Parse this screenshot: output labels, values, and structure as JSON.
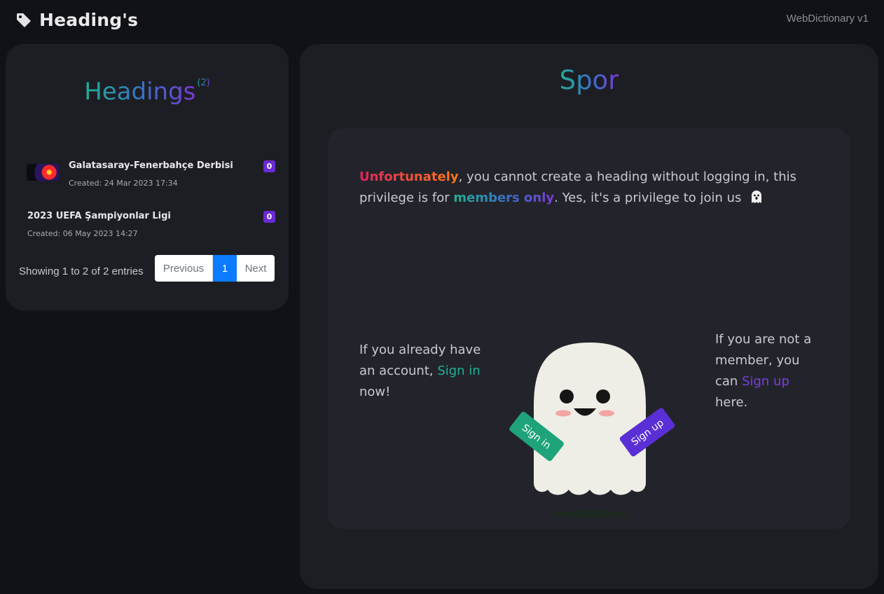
{
  "header": {
    "title": "Heading's",
    "title_icon": "tag-icon",
    "app_version": "WebDictionary v1"
  },
  "sidebar": {
    "title": "Headings",
    "count": "(2)",
    "items": [
      {
        "name": "Galatasaray-Fenerbahçe Derbisi",
        "created": "Created: 24 Mar 2023 17:34",
        "badge": "0",
        "has_thumbnail": true
      },
      {
        "name": "2023 UEFA Şampiyonlar Ligi",
        "created": "Created: 06 May 2023 14:27",
        "badge": "0",
        "has_thumbnail": false
      }
    ],
    "entries_info": "Showing 1 to 2 of 2 entries",
    "pagination": {
      "previous": "Previous",
      "current": "1",
      "next": "Next"
    }
  },
  "main": {
    "title": "Spor",
    "notice": {
      "warn": "Unfortunately",
      "part1": ", you cannot create a heading without logging in, this privilege is for ",
      "members": "members only",
      "part2": ". Yes, it's a privilege to join us"
    },
    "signin": {
      "line1": "If you already have an account, ",
      "link": "Sign in",
      "line2": " now!"
    },
    "signup": {
      "line1": "If you are not a member, you can ",
      "link": "Sign up",
      "line2": " here."
    },
    "illustration": {
      "sign_in_label": "Sign in",
      "sign_up_label": "Sign up"
    }
  },
  "colors": {
    "background": "#111217",
    "card": "#1d1e24",
    "panel": "#23242b",
    "accent_green": "#1fb193",
    "accent_purple": "#7a3ee0",
    "badge": "#6a2ad4",
    "page_active": "#0d7bff"
  }
}
